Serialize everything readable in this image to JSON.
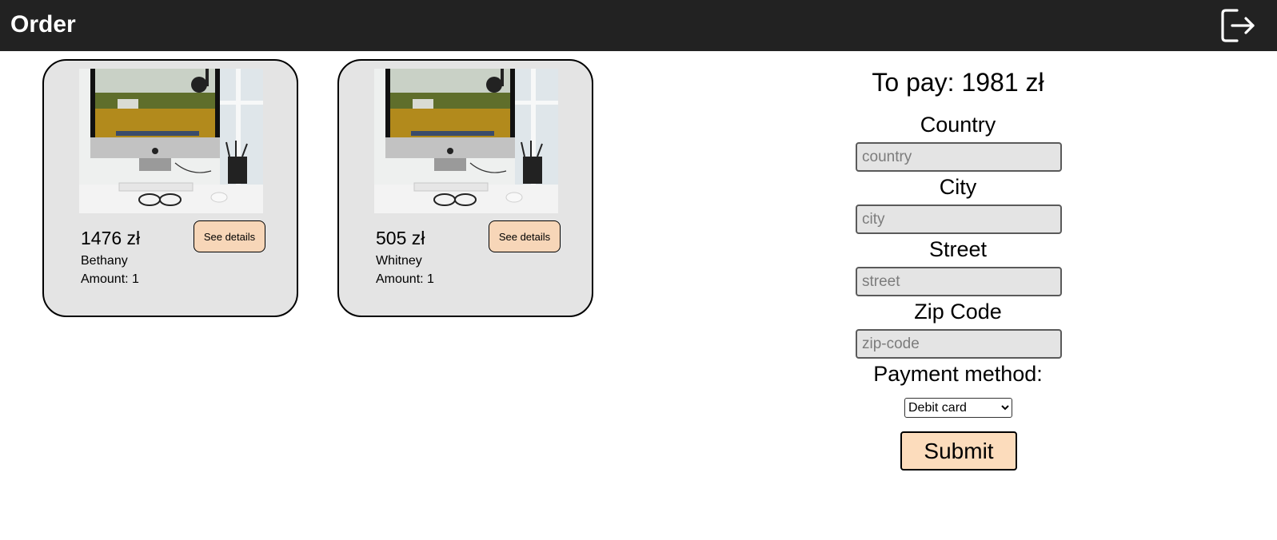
{
  "header": {
    "title": "Order",
    "logout_icon": "logout-icon"
  },
  "colors": {
    "header_bg": "#222222",
    "card_bg": "#e4e4e4",
    "button_bg": "#f7d6b8",
    "submit_bg": "#fcdcbc"
  },
  "products": [
    {
      "price": "1476 zł",
      "name": "Bethany",
      "amount": "Amount: 1",
      "details_label": "See details",
      "image": "imac-desk-photo"
    },
    {
      "price": "505 zł",
      "name": "Whitney",
      "amount": "Amount: 1",
      "details_label": "See details",
      "image": "imac-desk-photo"
    }
  ],
  "checkout": {
    "to_pay": "To pay: 1981 zł",
    "country_label": "Country",
    "country_placeholder": "country",
    "city_label": "City",
    "city_placeholder": "city",
    "street_label": "Street",
    "street_placeholder": "street",
    "zip_label": "Zip Code",
    "zip_placeholder": "zip-code",
    "payment_label": "Payment method:",
    "payment_selected": "Debit card",
    "submit_label": "Submit"
  }
}
